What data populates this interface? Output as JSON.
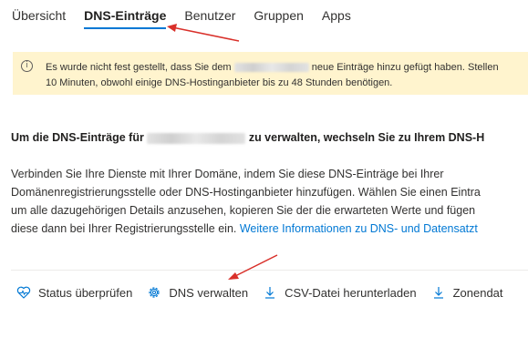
{
  "tabs": [
    {
      "label": "Übersicht"
    },
    {
      "label": "DNS-Einträge",
      "active": true
    },
    {
      "label": "Benutzer"
    },
    {
      "label": "Gruppen"
    },
    {
      "label": "Apps"
    }
  ],
  "notice": {
    "line1_before": "Es wurde nicht fest gestellt, dass Sie dem",
    "line1_after": "neue Einträge hinzu gefügt haben. Stellen",
    "line2": "10 Minuten, obwohl einige DNS-Hostinganbieter bis zu 48 Stunden benötigen.",
    "icon": "info-icon"
  },
  "heading": {
    "before": "Um die DNS-Einträge für",
    "after": "zu verwalten, wechseln Sie zu Ihrem DNS-H"
  },
  "paragraph": {
    "line1": "Verbinden Sie Ihre Dienste mit Ihrer Domäne, indem Sie diese DNS-Einträge bei Ihrer",
    "line2": "Domänenregistrierungsstelle oder DNS-Hostinganbieter hinzufügen. Wählen Sie einen Eintra",
    "line3": "um alle dazugehörigen Details anzusehen, kopieren Sie der die erwarteten Werte und fügen",
    "line4": "diese dann bei Ihrer Registrierungsstelle ein.",
    "link": "Weitere Informationen zu DNS- und Datensatzt"
  },
  "toolbar": {
    "status": "Status überprüfen",
    "manage": "DNS verwalten",
    "csv": "CSV-Datei herunterladen",
    "zone": "Zonendat"
  },
  "colors": {
    "accent": "#0078d4",
    "notice_bg": "#fff4ce",
    "annotation_arrow": "#d9302a"
  }
}
